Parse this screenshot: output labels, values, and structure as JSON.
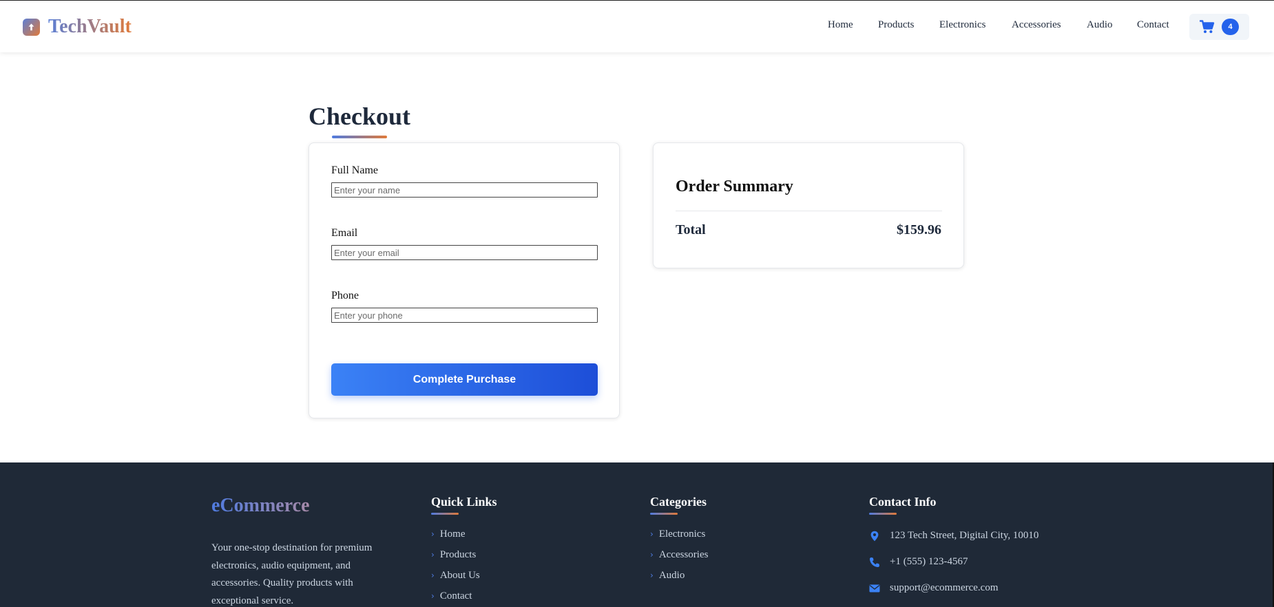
{
  "header": {
    "logo_text": "TechVault",
    "nav": [
      "Home",
      "Products",
      "Electronics",
      "Accessories",
      "Audio",
      "Contact"
    ],
    "cart_count": "4"
  },
  "checkout": {
    "title": "Checkout",
    "fields": [
      {
        "label": "Full Name",
        "placeholder": "Enter your name",
        "value": ""
      },
      {
        "label": "Email",
        "placeholder": "Enter your email",
        "value": ""
      },
      {
        "label": "Phone",
        "placeholder": "Enter your phone",
        "value": ""
      }
    ],
    "submit_label": "Complete Purchase"
  },
  "summary": {
    "title": "Order Summary",
    "total_label": "Total",
    "total_value": "$159.96"
  },
  "footer": {
    "brand": "eCommerce",
    "description": "Your one-stop destination for premium electronics, audio equipment, and accessories. Quality products with exceptional service.",
    "quick_links": {
      "title": "Quick Links",
      "items": [
        "Home",
        "Products",
        "About Us",
        "Contact"
      ]
    },
    "categories": {
      "title": "Categories",
      "items": [
        "Electronics",
        "Accessories",
        "Audio"
      ]
    },
    "contact": {
      "title": "Contact Info",
      "address": "123 Tech Street, Digital City, 10010",
      "phone": "+1 (555) 123-4567",
      "email": "support@ecommerce.com"
    }
  },
  "colors": {
    "accent": "#2563eb",
    "accent_secondary": "#e07a3a",
    "footer_bg": "#1f2937"
  },
  "icons": {
    "logo": "upload-arrow-icon",
    "cart": "shopping-cart-icon",
    "address": "map-pin-icon",
    "phone": "phone-icon",
    "email": "envelope-icon"
  }
}
